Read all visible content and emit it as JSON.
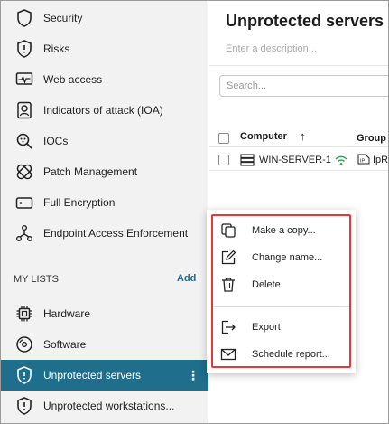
{
  "sidebar": {
    "items": [
      {
        "label": "Security",
        "icon": "shield-icon"
      },
      {
        "label": "Risks",
        "icon": "risk-shield-icon"
      },
      {
        "label": "Web access",
        "icon": "pulse-monitor-icon"
      },
      {
        "label": "Indicators of attack (IOA)",
        "icon": "person-badge-icon"
      },
      {
        "label": "IOCs",
        "icon": "magnifier-icon"
      },
      {
        "label": "Patch Management",
        "icon": "bandage-icon"
      },
      {
        "label": "Full Encryption",
        "icon": "drive-lock-icon"
      },
      {
        "label": "Endpoint Access Enforcement",
        "icon": "network-nodes-icon"
      }
    ],
    "my_lists_label": "MY LISTS",
    "add_label": "Add",
    "lists": [
      {
        "label": "Hardware",
        "icon": "chip-icon",
        "active": false
      },
      {
        "label": "Software",
        "icon": "disc-icon",
        "active": false
      },
      {
        "label": "Unprotected servers",
        "icon": "shield-alert-icon",
        "active": true
      },
      {
        "label": "Unprotected workstations...",
        "icon": "shield-alert-icon",
        "active": false
      }
    ],
    "more_glyph": "⋮"
  },
  "main": {
    "title": "Unprotected servers",
    "description_placeholder": "Enter a description...",
    "search_placeholder": "Search...",
    "columns": {
      "computer": "Computer",
      "sort_glyph": "↑",
      "group": "Group"
    },
    "rows": [
      {
        "computer": "WIN-SERVER-1",
        "group": "IpR"
      }
    ]
  },
  "context_menu": {
    "items": [
      {
        "label": "Make a copy...",
        "icon": "copy-icon"
      },
      {
        "label": "Change name...",
        "icon": "edit-icon"
      },
      {
        "label": "Delete",
        "icon": "trash-icon"
      },
      {
        "label": "Export",
        "icon": "export-icon"
      },
      {
        "label": "Schedule report...",
        "icon": "envelope-icon"
      }
    ]
  },
  "colors": {
    "accent": "#1e6e8c",
    "highlight": "#e03a3a",
    "sidebar_bg": "#f2f2f2",
    "status_green": "#2e9e5b"
  }
}
